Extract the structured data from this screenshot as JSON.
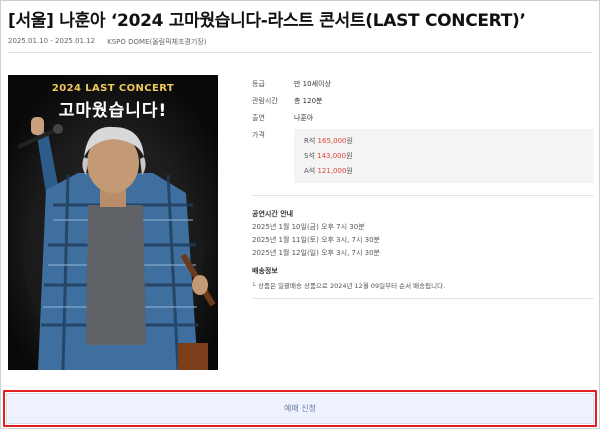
{
  "page": {
    "title": "[서울] 나훈아 ‘2024 고마웠습니다-라스트 콘서트(LAST CONCERT)’",
    "period": "2025.01.10 - 2025.01.12",
    "venue": "KSPO DOME(올림픽체조경기장)"
  },
  "poster": {
    "top_text": "2024 LAST CONCERT",
    "main_text": "고마웠습니다!"
  },
  "info": {
    "rating_label": "등급",
    "rating_value": "만 10세이상",
    "runtime_label": "관람시간",
    "runtime_value": "총 120분",
    "cast_label": "출연",
    "cast_value": "나훈아",
    "price_label": "가격",
    "prices": [
      {
        "seat": "R석 ",
        "amount": "165,000",
        "unit": "원"
      },
      {
        "seat": "S석 ",
        "amount": "143,000",
        "unit": "원"
      },
      {
        "seat": "A석 ",
        "amount": "121,000",
        "unit": "원"
      }
    ]
  },
  "schedule": {
    "title": "공연시간 안내",
    "items": [
      "2025년 1월 10일(금) 오후 7시 30분",
      "2025년 1월 11일(토) 오후 3시, 7시 30분",
      "2025년 1월 12일(일) 오후 3시, 7시 30분"
    ]
  },
  "delivery": {
    "title": "배송정보",
    "text": "└ 상품은 일괄배송 상품으로 2024년 12월 09일부터 순서 배송됩니다."
  },
  "cta": {
    "label": "예매 신청"
  },
  "colors": {
    "price_accent": "#e0453a",
    "cta_background": "#eef2ff",
    "highlight_outline": "#e02020"
  }
}
